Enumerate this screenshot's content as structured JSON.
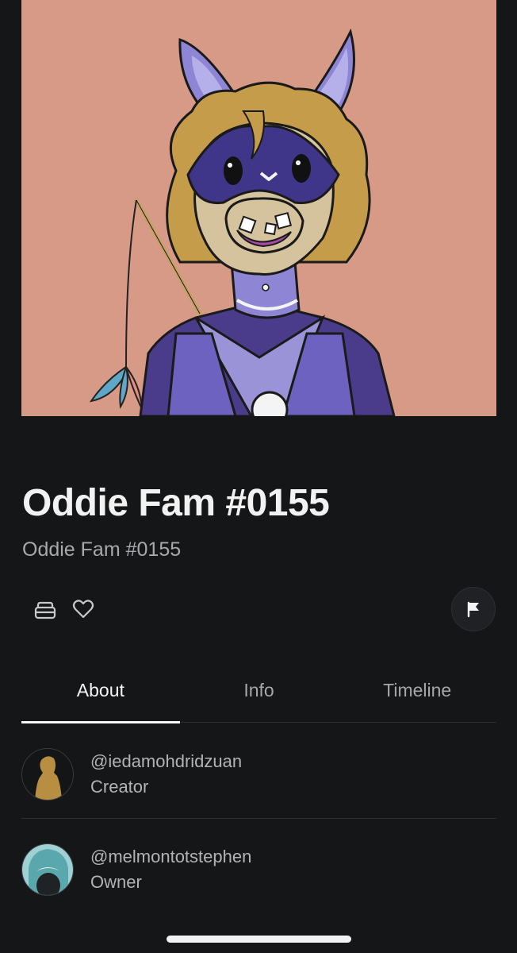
{
  "nft": {
    "title": "Oddie Fam #0155",
    "collection": "Oddie Fam #0155"
  },
  "actions": {
    "collection_icon": "stack-icon",
    "favorite_icon": "heart-icon",
    "report_icon": "flag-icon"
  },
  "tabs": [
    {
      "label": "About",
      "active": true
    },
    {
      "label": "Info",
      "active": false
    },
    {
      "label": "Timeline",
      "active": false
    }
  ],
  "people": {
    "creator": {
      "handle": "@iedamohdridzuan",
      "role": "Creator"
    },
    "owner": {
      "handle": "@melmontotstephen",
      "role": "Owner"
    }
  },
  "colors": {
    "background": "#151618",
    "artwork_bg": "#d69a86",
    "text_primary": "#f2f2f2",
    "text_secondary": "#a9a9ad"
  }
}
